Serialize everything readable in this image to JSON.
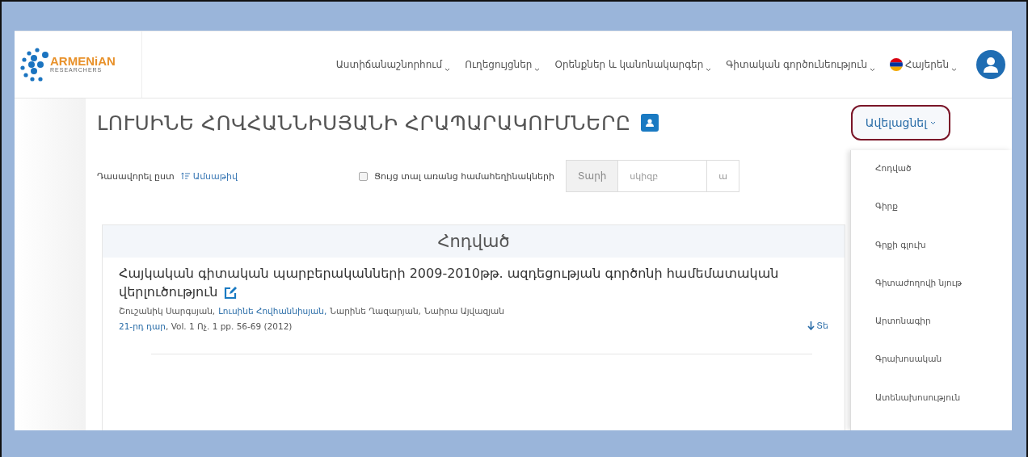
{
  "logo": {
    "name": "ARMENiAN",
    "tagline": "RESEARCHERS"
  },
  "nav": [
    {
      "label": "Աստիճանաշնորհում"
    },
    {
      "label": "Ուղեցույցներ"
    },
    {
      "label": "Օրենքներ և կանոնակարգեր"
    },
    {
      "label": "Գիտական գործունեություն"
    }
  ],
  "language": {
    "label": "Հայերեն"
  },
  "page_title": "ԼՈՒՍԻՆԵ ՀՈՎՀԱՆՆԻՍՅԱՆԻ ՀՐԱՊԱՐԱԿՈՒՄՆԵՐԸ",
  "add_button": {
    "label": "Ավելացնել"
  },
  "add_menu": [
    {
      "label": "Հոդված"
    },
    {
      "label": "Գիրք"
    },
    {
      "label": "Գրքի գլուխ"
    },
    {
      "label": "Գիտաժողովի նյութ"
    },
    {
      "label": "Արտոնագիր"
    },
    {
      "label": "Գրախոսական"
    },
    {
      "label": "Ատենախոսություն"
    }
  ],
  "sort": {
    "label": "Դասավորել ըստ",
    "value": "Ամսաթիվ"
  },
  "coauthor_filter": {
    "label": "Ցույց տալ առանց համահեղինակների",
    "checked": false
  },
  "year_filter": {
    "label": "Տարի",
    "from_placeholder": "սկիզբ",
    "to_placeholder": "ա"
  },
  "section": {
    "title": "Հոդված",
    "items": [
      {
        "title": "Հայկական գիտական պարբերականների 2009-2010թթ. ազդեցության գործոնի համեմատական վերլուծություն",
        "authors": [
          {
            "name": "Շուշանիկ Սարգսյան,",
            "highlighted": false
          },
          {
            "name": "Լուսինե Հովհաննիսյան,",
            "highlighted": true
          },
          {
            "name": "Նարինե Ղազարյան,",
            "highlighted": false
          },
          {
            "name": "Նաիրա Այվազյան",
            "highlighted": false
          }
        ],
        "journal": "21-րդ դար",
        "details": ", Vol. 1 Ոչ. 1 pp. 56-69 (2012)",
        "download": "Տե"
      }
    ]
  }
}
